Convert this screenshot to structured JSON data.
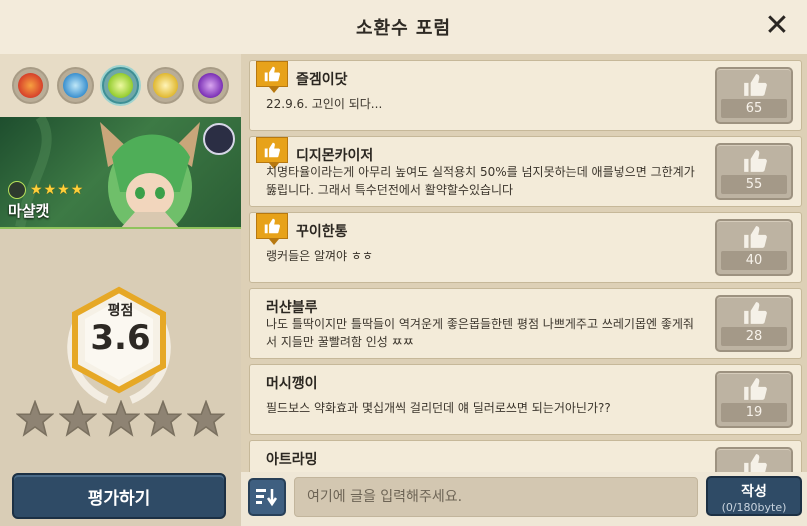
{
  "header": {
    "title": "소환수 포럼"
  },
  "sidebar": {
    "elements": [
      {
        "name": "fire",
        "color": "#e0563a"
      },
      {
        "name": "water",
        "color": "#4aa6d8"
      },
      {
        "name": "wind",
        "color": "#b8e04a",
        "selected": true
      },
      {
        "name": "light",
        "color": "#f0d060"
      },
      {
        "name": "dark",
        "color": "#9b4ad0"
      }
    ],
    "monster": {
      "name": "마샬캣",
      "stars": 4,
      "element_color": "#b8e04a"
    },
    "rating": {
      "label": "평점",
      "value": "3.6",
      "stars_filled": 0,
      "stars_total": 5
    },
    "rate_button": "평가하기"
  },
  "posts": [
    {
      "author": "즐겜이닷",
      "body": "22.9.6.  고인이 되다...",
      "likes": "65",
      "top": true
    },
    {
      "author": "디지몬카이저",
      "body": "치명타율이라는게 아무리 높여도 실적용치 50%를 넘지못하는데 애를넣으면 그한계가 뚫립니다. 그래서 특수던전에서 활약할수있습니다",
      "likes": "55",
      "top": true
    },
    {
      "author": "꾸이한통",
      "body": "랭커들은 알껴야 ㅎㅎ",
      "likes": "40",
      "top": true
    },
    {
      "author": "러샨블루",
      "body": "나도 틀딱이지만 틀딱들이 역겨운게 좋은몹들한텐 평점 나쁘게주고 쓰레기몹엔 좋게줘서 지들만 꿀빨려함 인성 ㅉㅉ",
      "likes": "28",
      "top": false
    },
    {
      "author": "머시깽이",
      "body": "필드보스 약화효과 몇십개씩 걸리던데 얘 딜러로쓰면 되는거아닌가??",
      "likes": "19",
      "top": false
    },
    {
      "author": "아트라밍",
      "body": "",
      "likes": "",
      "top": false
    }
  ],
  "composer": {
    "placeholder": "여기에 글을 입력해주세요.",
    "submit_label": "작성",
    "char_limit": "(0/180byte)"
  }
}
